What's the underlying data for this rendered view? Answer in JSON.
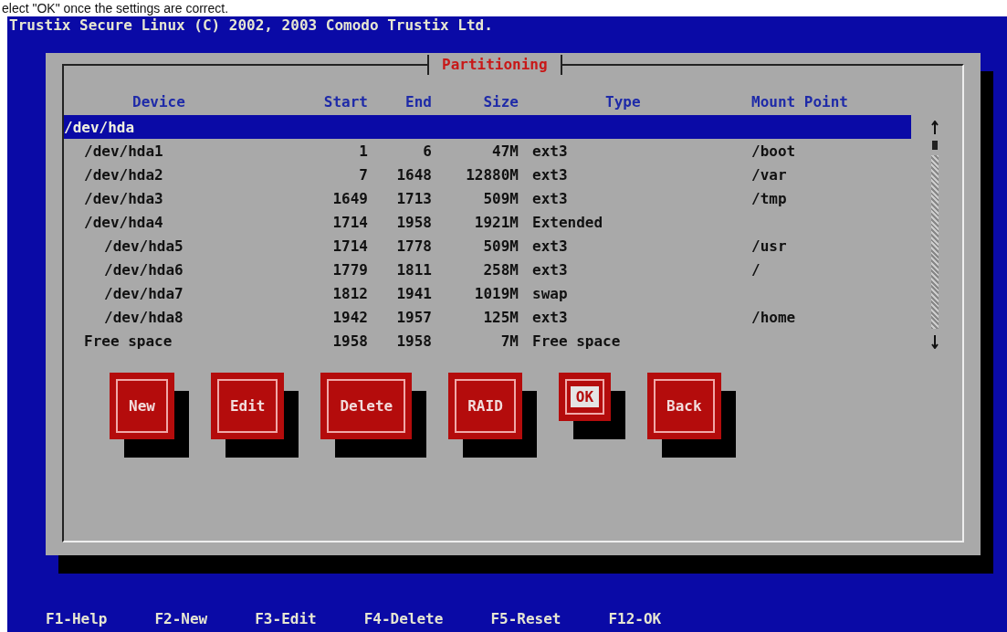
{
  "caption": "elect \"OK\" once the settings are correct.",
  "window": {
    "title": "Trustix Secure Linux (C) 2002, 2003 Comodo Trustix Ltd."
  },
  "dialog": {
    "title": "Partitioning",
    "table": {
      "columns": [
        "Device",
        "Start",
        "End",
        "Size",
        "Type",
        "Mount Point"
      ],
      "rows": [
        {
          "cells": [
            "/dev/hda",
            "",
            "",
            "",
            "",
            ""
          ],
          "selected": true,
          "children": [
            {
              "cells": [
                "/dev/hda1",
                "1",
                "6",
                "47M",
                "ext3",
                "/boot"
              ],
              "selected": false
            },
            {
              "cells": [
                "/dev/hda2",
                "7",
                "1648",
                "12880M",
                "ext3",
                "/var"
              ],
              "selected": false
            },
            {
              "cells": [
                "/dev/hda3",
                "1649",
                "1713",
                "509M",
                "ext3",
                "/tmp"
              ],
              "selected": false
            },
            {
              "cells": [
                "/dev/hda4",
                "1714",
                "1958",
                "1921M",
                "Extended",
                ""
              ],
              "selected": false,
              "children": [
                {
                  "cells": [
                    "/dev/hda5",
                    "1714",
                    "1778",
                    "509M",
                    "ext3",
                    "/usr"
                  ],
                  "selected": false
                },
                {
                  "cells": [
                    "/dev/hda6",
                    "1779",
                    "1811",
                    "258M",
                    "ext3",
                    "/"
                  ],
                  "selected": false
                },
                {
                  "cells": [
                    "/dev/hda7",
                    "1812",
                    "1941",
                    "1019M",
                    "swap",
                    ""
                  ],
                  "selected": false
                },
                {
                  "cells": [
                    "/dev/hda8",
                    "1942",
                    "1957",
                    "125M",
                    "ext3",
                    "/home"
                  ],
                  "selected": false
                }
              ]
            },
            {
              "cells": [
                "Free space",
                "1958",
                "1958",
                "7M",
                "Free space",
                ""
              ],
              "selected": false
            }
          ]
        }
      ]
    },
    "buttons": [
      {
        "label": "New",
        "selected": false
      },
      {
        "label": "Edit",
        "selected": false
      },
      {
        "label": "Delete",
        "selected": false
      },
      {
        "label": "RAID",
        "selected": false
      },
      {
        "label": "OK",
        "selected": true
      },
      {
        "label": "Back",
        "selected": false
      }
    ]
  },
  "status_bar": [
    "F1-Help",
    "F2-New",
    "F3-Edit",
    "F4-Delete",
    "F5-Reset",
    "F12-OK"
  ]
}
